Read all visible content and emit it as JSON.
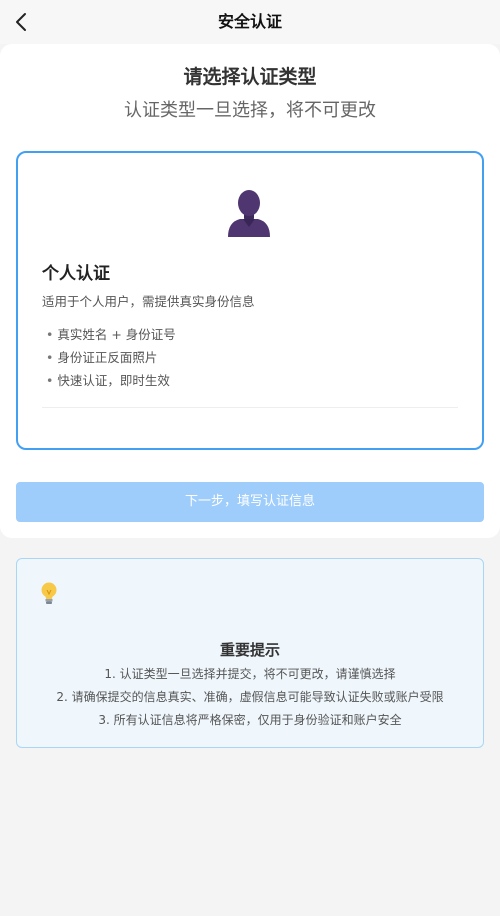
{
  "header": {
    "title": "安全认证",
    "back_icon": "chevron-left-icon"
  },
  "intro": {
    "title": "请选择认证类型",
    "subtitle": "认证类型一旦选择，将不可更改"
  },
  "option": {
    "icon": "person-avatar-icon",
    "title": "个人认证",
    "description": "适用于个人用户，需提供真实身份信息",
    "bullet": "•",
    "features": [
      "真实姓名 + 身份证号",
      "身份证正反面照片",
      "快速认证，即时生效"
    ],
    "selected": true
  },
  "next_button": {
    "label": "下一步，填写认证信息",
    "disabled": true
  },
  "tips": {
    "icon": "lightbulb-icon",
    "title": "重要提示",
    "items": [
      "1. 认证类型一旦选择并提交，将不可更改，请谨慎选择",
      "2. 请确保提交的信息真实、准确，虚假信息可能导致认证失败或账户受限",
      "3. 所有认证信息将严格保密，仅用于身份验证和账户安全"
    ]
  },
  "colors": {
    "accent": "#42a0f2",
    "button_disabled": "#9fcdfb",
    "tips_background": "#eff7fd",
    "avatar": "#4f3670"
  }
}
